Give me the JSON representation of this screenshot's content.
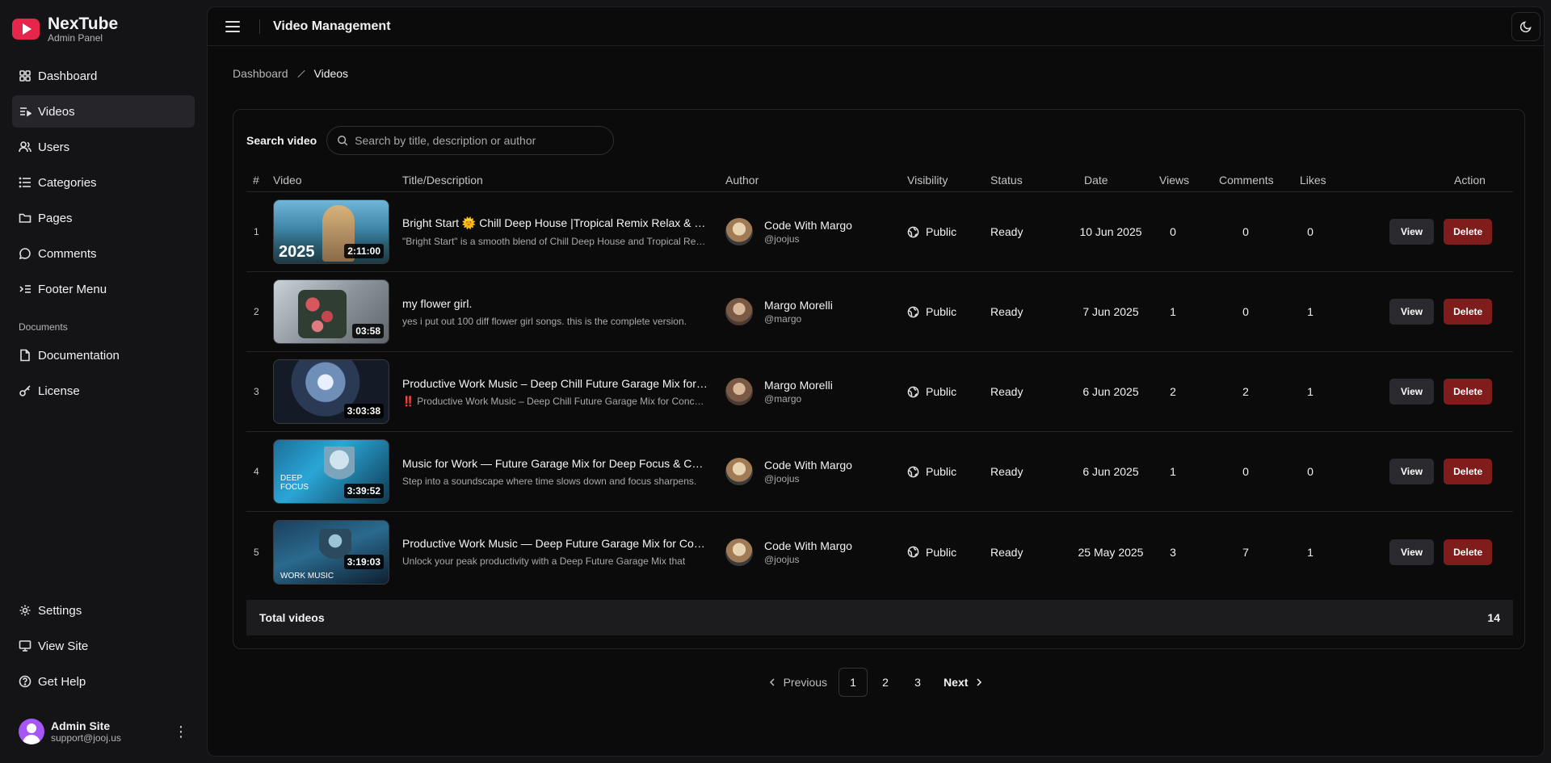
{
  "brand": {
    "name": "NexTube",
    "subtitle": "Admin Panel",
    "accent": "#e6264a"
  },
  "sidebar": {
    "items": [
      {
        "label": "Dashboard",
        "icon": "dashboard-icon"
      },
      {
        "label": "Videos",
        "icon": "videos-icon",
        "active": true
      },
      {
        "label": "Users",
        "icon": "users-icon"
      },
      {
        "label": "Categories",
        "icon": "categories-icon"
      },
      {
        "label": "Pages",
        "icon": "folder-icon"
      },
      {
        "label": "Comments",
        "icon": "comment-icon"
      },
      {
        "label": "Footer Menu",
        "icon": "footer-menu-icon"
      }
    ],
    "documents_label": "Documents",
    "documents": [
      {
        "label": "Documentation",
        "icon": "document-icon"
      },
      {
        "label": "License",
        "icon": "key-icon"
      }
    ],
    "bottom": [
      {
        "label": "Settings",
        "icon": "gear-icon"
      },
      {
        "label": "View Site",
        "icon": "monitor-icon"
      },
      {
        "label": "Get Help",
        "icon": "help-icon"
      }
    ],
    "user": {
      "name": "Admin Site",
      "email": "support@jooj.us"
    }
  },
  "header": {
    "title": "Video Management"
  },
  "breadcrumb": {
    "home": "Dashboard",
    "current": "Videos"
  },
  "search": {
    "label": "Search video",
    "placeholder": "Search by title, description or author",
    "value": ""
  },
  "table": {
    "columns": [
      "#",
      "Video",
      "Title/Description",
      "Author",
      "Visibility",
      "Status",
      "Date",
      "Views",
      "Comments",
      "Likes",
      "Action"
    ],
    "rows": [
      {
        "num": "1",
        "duration": "2:11:00",
        "title": "Bright Start 🌞 Chill Deep House |Tropical Remix Relax & Focus Music",
        "desc": "\"Bright Start\" is a smooth blend of Chill Deep House and Tropical Remix vibes",
        "author": "Code With Margo",
        "handle": "@joojus",
        "visibility": "Public",
        "status": "Ready",
        "date": "10 Jun 2025",
        "views": "0",
        "comments": "0",
        "likes": "0",
        "thumb_text": "2025"
      },
      {
        "num": "2",
        "duration": "03:58",
        "title": "my flower girl.",
        "desc": "yes i put out 100 diff flower girl songs. this is the complete version.",
        "author": "Margo Morelli",
        "handle": "@margo",
        "visibility": "Public",
        "status": "Ready",
        "date": "7 Jun 2025",
        "views": "1",
        "comments": "0",
        "likes": "1",
        "thumb_text": ""
      },
      {
        "num": "3",
        "duration": "3:03:38",
        "title": "Productive Work Music – Deep Chill Future Garage Mix for Concentration",
        "desc": "‼️ Productive Work Music – Deep Chill Future Garage Mix for Concentration",
        "author": "Margo Morelli",
        "handle": "@margo",
        "visibility": "Public",
        "status": "Ready",
        "date": "6 Jun 2025",
        "views": "2",
        "comments": "2",
        "likes": "1",
        "thumb_text": ""
      },
      {
        "num": "4",
        "duration": "3:39:52",
        "title": "Music for Work — Future Garage Mix for Deep Focus & Concentration",
        "desc": "Step into a soundscape where time slows down and focus sharpens.",
        "author": "Code With Margo",
        "handle": "@joojus",
        "visibility": "Public",
        "status": "Ready",
        "date": "6 Jun 2025",
        "views": "1",
        "comments": "0",
        "likes": "0",
        "thumb_text": "DEEP FOCUS"
      },
      {
        "num": "5",
        "duration": "3:19:03",
        "title": "Productive Work Music — Deep Future Garage Mix for Concentration",
        "desc": "Unlock your peak productivity with a Deep Future Garage Mix that",
        "author": "Code With Margo",
        "handle": "@joojus",
        "visibility": "Public",
        "status": "Ready",
        "date": "25 May 2025",
        "views": "3",
        "comments": "7",
        "likes": "1",
        "thumb_text": "WORK MUSIC"
      }
    ],
    "view_label": "View",
    "delete_label": "Delete",
    "total_label": "Total videos",
    "total_count": "14"
  },
  "pagination": {
    "previous": "Previous",
    "pages": [
      "1",
      "2",
      "3"
    ],
    "current": "1",
    "next": "Next"
  }
}
